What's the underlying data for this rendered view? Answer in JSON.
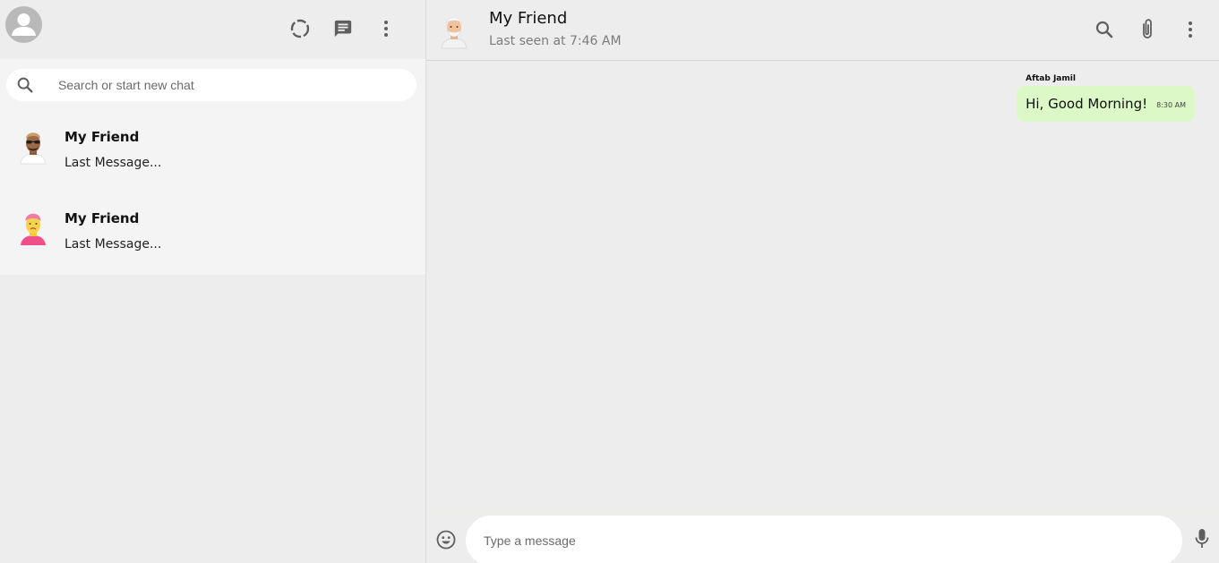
{
  "sidebar": {
    "header": {
      "user_avatar_icon": "person-icon",
      "actions": [
        {
          "name": "status-icon"
        },
        {
          "name": "new-chat-icon"
        },
        {
          "name": "more-vert-icon"
        }
      ]
    },
    "search": {
      "placeholder": "Search or start new chat",
      "value": ""
    },
    "chats": [
      {
        "name": "My Friend",
        "last_message": "Last Message..."
      },
      {
        "name": "My Friend",
        "last_message": "Last Message..."
      }
    ]
  },
  "main": {
    "header": {
      "contact_name": "My Friend",
      "status": "Last seen at 7:46 AM",
      "actions": [
        {
          "name": "search-icon"
        },
        {
          "name": "attach-icon"
        },
        {
          "name": "more-vert-icon"
        }
      ]
    },
    "messages": [
      {
        "sender": "Aftab Jamil",
        "text": "Hi, Good Morning!",
        "time": "8:30 AM"
      }
    ],
    "footer": {
      "placeholder": "Type a message",
      "value": ""
    }
  },
  "colors": {
    "background": "#ededed",
    "chat_panel": "#f4f4f4",
    "bubble": "#dcf8c6",
    "icon": "#5f5f5f"
  }
}
